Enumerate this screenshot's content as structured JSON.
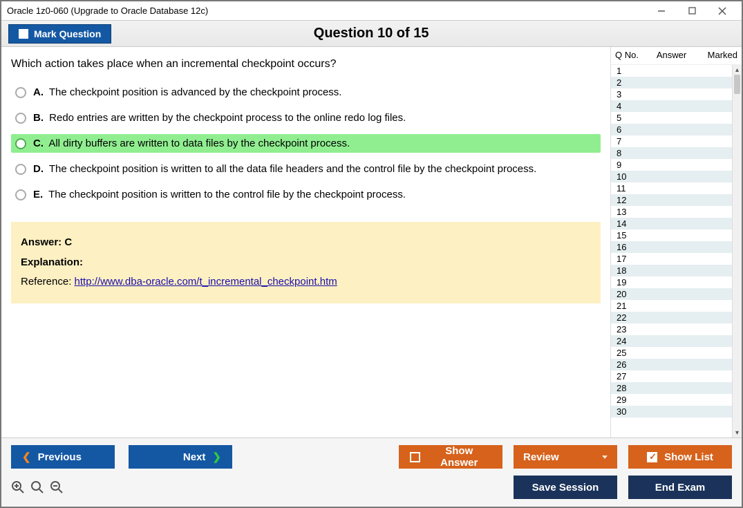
{
  "window": {
    "title": "Oracle 1z0-060 (Upgrade to Oracle Database 12c)"
  },
  "header": {
    "mark_label": "Mark Question",
    "question_counter": "Question 10 of 15"
  },
  "question": {
    "stem": "Which action takes place when an incremental checkpoint occurs?",
    "options": [
      {
        "letter": "A.",
        "text": "The checkpoint position is advanced by the checkpoint process.",
        "highlight": false
      },
      {
        "letter": "B.",
        "text": "Redo entries are written by the checkpoint process to the online redo log files.",
        "highlight": false
      },
      {
        "letter": "C.",
        "text": "All dirty buffers are written to data files by the checkpoint process.",
        "highlight": true
      },
      {
        "letter": "D.",
        "text": "The checkpoint position is written to all the data file headers and the control file by the checkpoint process.",
        "highlight": false
      },
      {
        "letter": "E.",
        "text": "The checkpoint position is written to the control file by the checkpoint process.",
        "highlight": false
      }
    ]
  },
  "answer_panel": {
    "answer_line": "Answer: C",
    "explanation_label": "Explanation:",
    "reference_label": "Reference: ",
    "reference_link_text": "http://www.dba-oracle.com/t_incremental_checkpoint.htm"
  },
  "sidepanel": {
    "headers": {
      "qno": "Q No.",
      "answer": "Answer",
      "marked": "Marked"
    },
    "rows": [
      "1",
      "2",
      "3",
      "4",
      "5",
      "6",
      "7",
      "8",
      "9",
      "10",
      "11",
      "12",
      "13",
      "14",
      "15",
      "16",
      "17",
      "18",
      "19",
      "20",
      "21",
      "22",
      "23",
      "24",
      "25",
      "26",
      "27",
      "28",
      "29",
      "30"
    ]
  },
  "buttons": {
    "previous": "Previous",
    "next": "Next",
    "show_answer": "Show Answer",
    "review": "Review",
    "show_list": "Show List",
    "save_session": "Save Session",
    "end_exam": "End Exam"
  }
}
